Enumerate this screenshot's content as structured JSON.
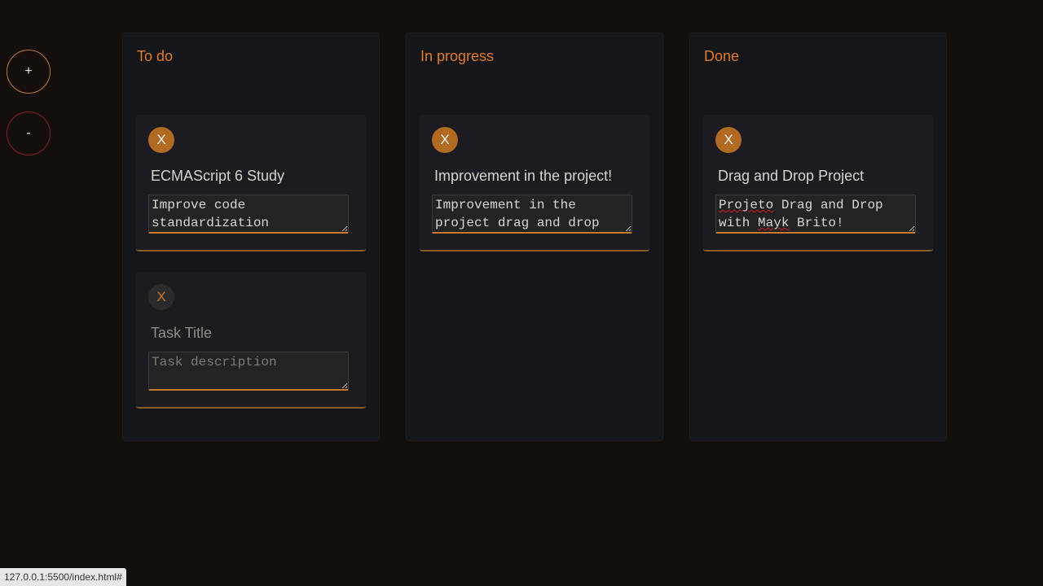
{
  "sidebar": {
    "add_label": "+",
    "remove_label": "-"
  },
  "columns": [
    {
      "title": "To do",
      "cards": [
        {
          "delete_label": "X",
          "title": "ECMAScript 6 Study",
          "description_line1": "Improve code",
          "description_line2": "standardization"
        },
        {
          "delete_label": "X",
          "title_placeholder": "Task Title",
          "description_placeholder": "Task description"
        }
      ]
    },
    {
      "title": "In progress",
      "cards": [
        {
          "delete_label": "X",
          "title": "Improvement in the project!",
          "description_line1": "Improvement in the",
          "description_line2": "project drag and drop"
        }
      ]
    },
    {
      "title": "Done",
      "cards": [
        {
          "delete_label": "X",
          "title": "Drag and Drop Project",
          "desc_w1": "Projeto",
          "desc_rest1": " Drag and Drop",
          "desc_w2": "with ",
          "desc_w3": "Mayk",
          "desc_rest2": " Brito!"
        }
      ]
    }
  ],
  "status_bar": {
    "url": "127.0.0.1:5500/index.html#"
  },
  "colors": {
    "background": "#120f0d",
    "column_bg": "#15161a",
    "card_bg": "#1c1c20",
    "accent": "#e07a26",
    "delete_button": "#b06a22",
    "remove_border": "#8a2020"
  },
  "icons": {
    "add": "plus-icon",
    "remove": "minus-icon",
    "delete": "close-icon"
  }
}
